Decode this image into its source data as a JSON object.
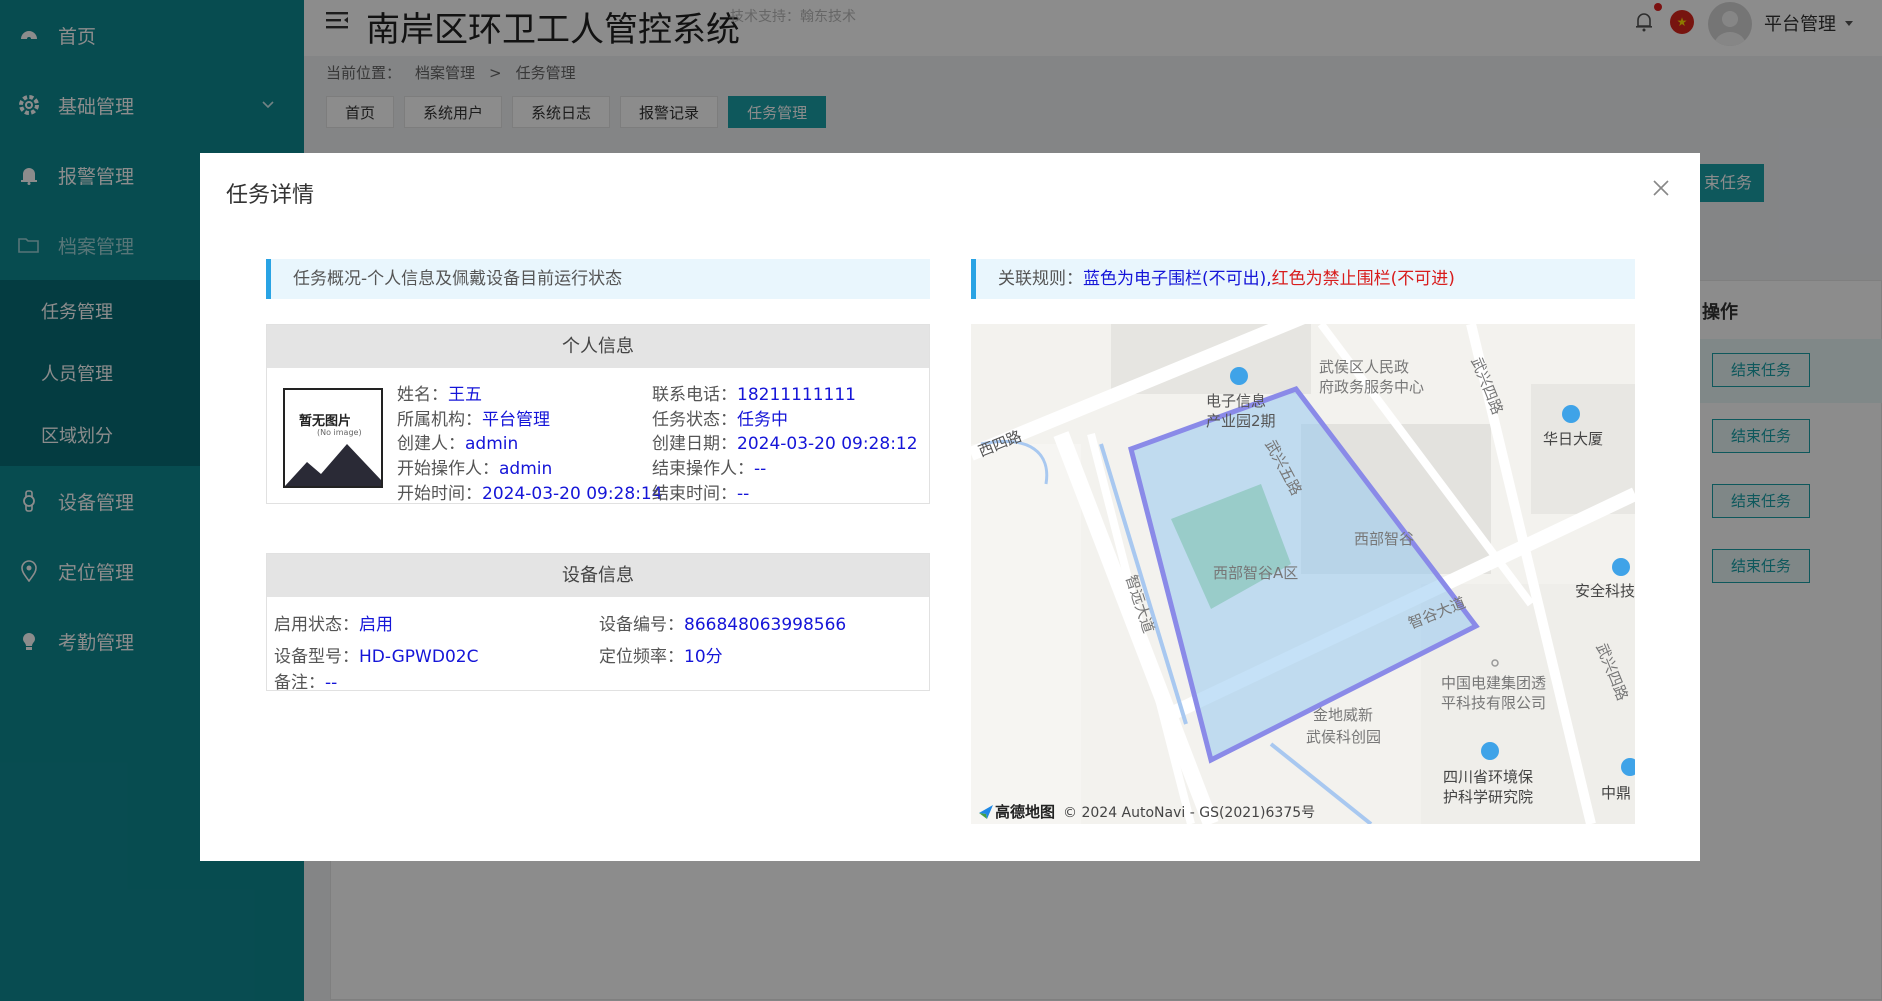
{
  "sidebar": {
    "items": [
      {
        "label": "首页"
      },
      {
        "label": "基础管理"
      },
      {
        "label": "报警管理"
      },
      {
        "label": "档案管理"
      },
      {
        "label": "设备管理"
      },
      {
        "label": "定位管理"
      },
      {
        "label": "考勤管理"
      }
    ],
    "sub_items": [
      {
        "label": "任务管理"
      },
      {
        "label": "人员管理"
      },
      {
        "label": "区域划分"
      }
    ]
  },
  "header": {
    "title": "南岸区环卫工人管控系统",
    "support": "技术支持：翰东技术",
    "user": "平台管理"
  },
  "breadcrumb": {
    "prefix": "当前位置：",
    "level1": "档案管理",
    "separator": ">",
    "level2": "任务管理"
  },
  "tabs": [
    {
      "label": "首页"
    },
    {
      "label": "系统用户"
    },
    {
      "label": "系统日志"
    },
    {
      "label": "报警记录"
    },
    {
      "label": "任务管理",
      "active": true
    }
  ],
  "background": {
    "end_task_button": "束任务",
    "operation_header": "操作",
    "row_button": "结束任务"
  },
  "modal": {
    "title": "任务详情",
    "overview_title": "任务概况-个人信息及佩戴设备目前运行状态",
    "rule_prefix": "关联规则：",
    "rule_blue": "蓝色为电子围栏(不可出),",
    "rule_red": "红色为禁止围栏(不可进)",
    "personal": {
      "title": "个人信息",
      "no_image": "暂无图片",
      "no_image_en": "(No image)",
      "fields": {
        "name_label": "姓名：",
        "name": "王五",
        "phone_label": "联系电话：",
        "phone": "18211111111",
        "org_label": "所属机构：",
        "org": "平台管理",
        "status_label": "任务状态：",
        "status": "任务中",
        "creator_label": "创建人：",
        "creator": "admin",
        "created_label": "创建日期：",
        "created": "2024-03-20 09:28:12",
        "start_op_label": "开始操作人：",
        "start_op": "admin",
        "end_op_label": "结束操作人：",
        "end_op": "--",
        "start_time_label": "开始时间：",
        "start_time": "2024-03-20 09:28:14",
        "end_time_label": "结束时间：",
        "end_time": "--"
      }
    },
    "device": {
      "title": "设备信息",
      "fields": {
        "enabled_label": "启用状态：",
        "enabled": "启用",
        "code_label": "设备编号：",
        "code": "866848063998566",
        "model_label": "设备型号：",
        "model": "HD-GPWD02C",
        "freq_label": "定位频率：",
        "freq": "10分",
        "remark_label": "备注：",
        "remark": "--"
      }
    },
    "map": {
      "labels": {
        "l1": "武侯区人民政",
        "l1b": "府政务服务中心",
        "l2": "电子信息",
        "l2b": "产业园2期",
        "l3": "武兴四路",
        "l4": "华日大厦",
        "l5": "西四路",
        "l6": "武兴五路",
        "l7": "西部智谷",
        "l8": "西部智谷A区",
        "l9": "智远大道",
        "l10": "智谷大道",
        "l11": "安全科技",
        "l12": "中国电建集团透",
        "l12b": "平科技有限公司",
        "l13": "金地威新",
        "l13b": "武侯科创园",
        "l14": "四川省环境保",
        "l14b": "护科学研究院",
        "l15": "中鼎",
        "l16": "武兴四路"
      },
      "brand": "高德地图",
      "copyright": "© 2024 AutoNavi - GS(2021)6375号"
    }
  }
}
